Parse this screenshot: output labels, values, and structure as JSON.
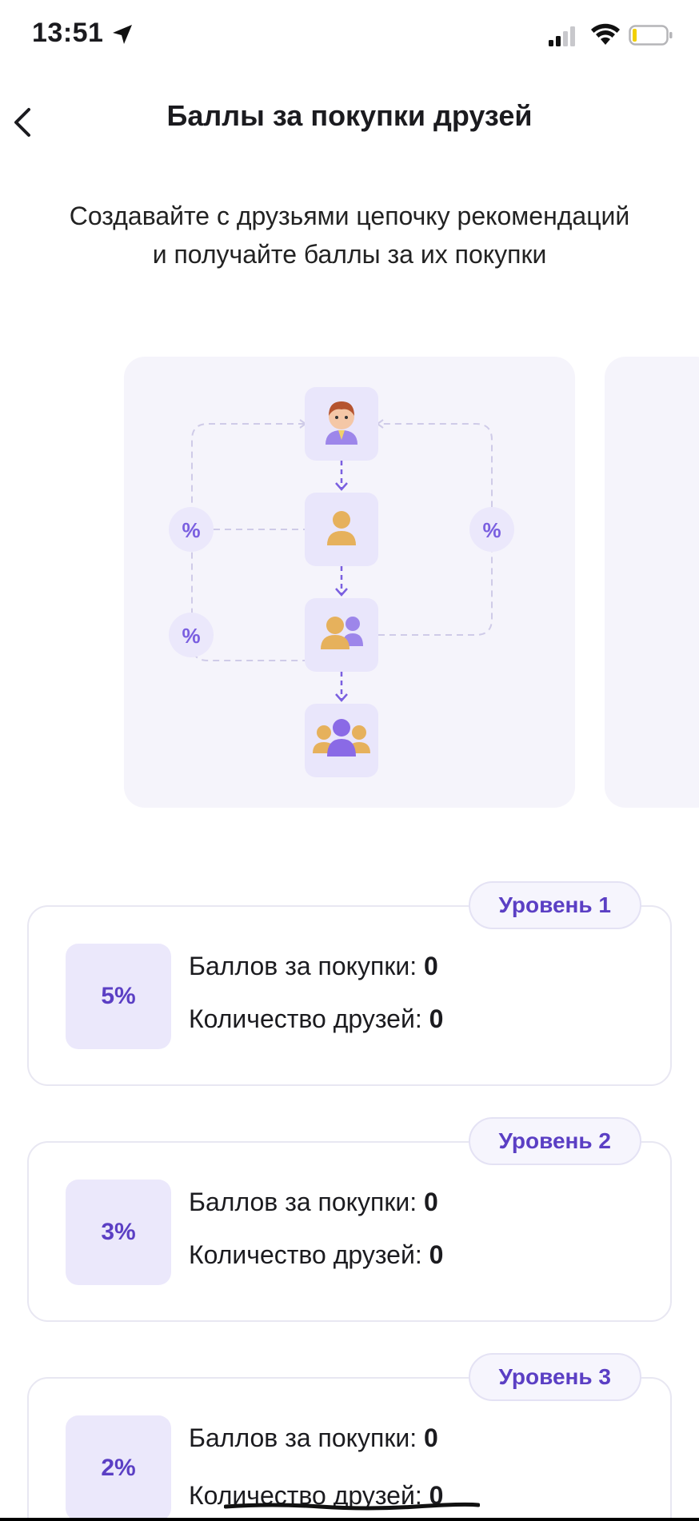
{
  "status_bar": {
    "time": "13:51"
  },
  "header": {
    "title": "Баллы за покупки друзей"
  },
  "subtitle": "Создавайте с друзьями цепочку рекомендаций и получайте баллы за их покупки",
  "illustration": {
    "percent_symbol": "%",
    "colors": {
      "card_bg": "#f5f4fb",
      "node_bg": "#e9e6fb",
      "accent": "#7a5fe0",
      "figure_yellow": "#e6b15c"
    }
  },
  "levels": [
    {
      "badge": "Уровень 1",
      "percent": "5%",
      "points_label": "Баллов за покупки: ",
      "points_value": "0",
      "friends_label": "Количество друзей: ",
      "friends_value": "0"
    },
    {
      "badge": "Уровень 2",
      "percent": "3%",
      "points_label": "Баллов за покупки: ",
      "points_value": "0",
      "friends_label": "Количество друзей: ",
      "friends_value": "0"
    },
    {
      "badge": "Уровень 3",
      "percent": "2%",
      "points_label": "Баллов за покупки: ",
      "points_value": "0",
      "friends_label": "Количество друзей: ",
      "friends_value": "0"
    }
  ],
  "colors": {
    "accent": "#5b3fc4",
    "badge_bg": "#f6f5fd",
    "percent_bg": "#ebe8fb",
    "border": "#e8e7f2"
  }
}
